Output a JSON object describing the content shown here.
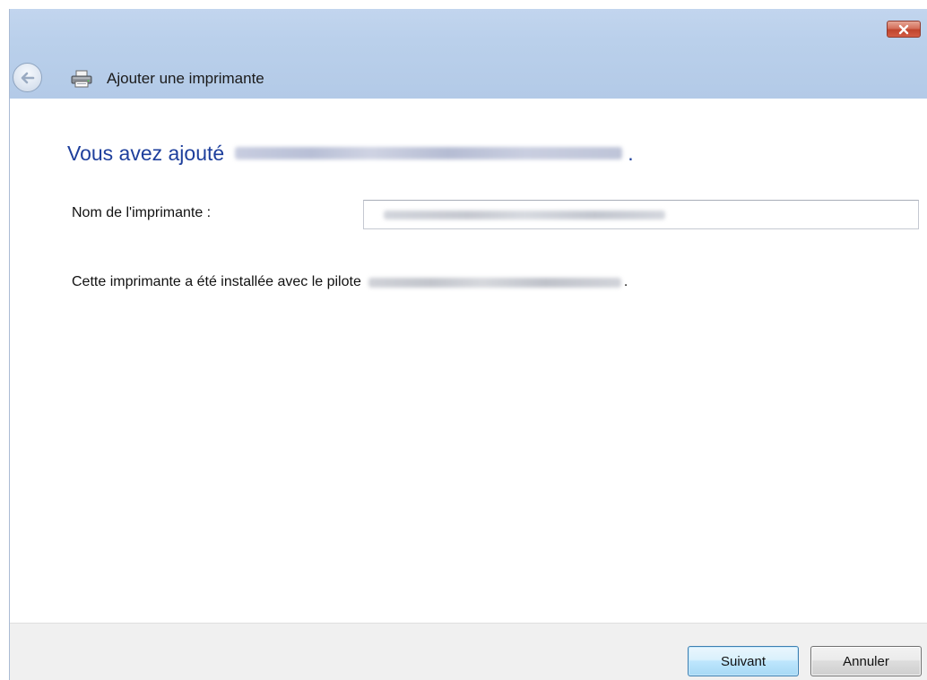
{
  "window": {
    "title": "Ajouter une imprimante",
    "close_glyph": "✕"
  },
  "content": {
    "heading_prefix": "Vous avez ajouté",
    "heading_suffix": ".",
    "name_label": "Nom de l'imprimante :",
    "driver_prefix": "Cette imprimante a été installée avec le pilote",
    "driver_suffix": "."
  },
  "footer": {
    "next_label": "Suivant",
    "cancel_label": "Annuler"
  },
  "icons": {
    "back": "back-arrow-icon",
    "printer": "printer-icon",
    "close": "close-icon"
  },
  "colors": {
    "titlebar": "#b9cfea",
    "heading": "#1e3f9c",
    "close_button": "#c9523d",
    "footer": "#f0f0f0",
    "next_button_border": "#3c7fb1"
  }
}
